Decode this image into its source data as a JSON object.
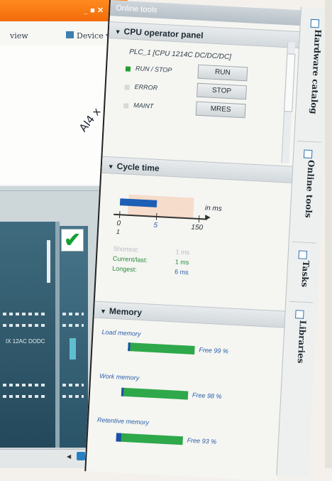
{
  "title_bar": {
    "window_controls": "_ ■ ✕",
    "mid_title": "Online tools"
  },
  "device_toolbar": {
    "network_view_tab": "view",
    "device_view_tab": "Device view"
  },
  "canvas": {
    "module_label": "AI4 x"
  },
  "plc_module": {
    "label": "IX 12AC DODC"
  },
  "cpu_panel": {
    "heading": "CPU operator panel",
    "device": "PLC_1 [CPU 1214C DC/DC/DC]",
    "rows": [
      {
        "indicator": "RUN / STOP",
        "button": "RUN",
        "led_color": "#20a030"
      },
      {
        "indicator": "ERROR",
        "button": "STOP",
        "led_color": "#d6d9da"
      },
      {
        "indicator": "MAINT",
        "button": "MRES",
        "led_color": "#d6d9da"
      }
    ]
  },
  "cycle_time": {
    "heading": "Cycle time",
    "unit": "in ms",
    "ticks": [
      "0",
      "5",
      "150"
    ],
    "tick_below": "1",
    "stats": [
      {
        "label": "Shortest:",
        "value": "1 ms"
      },
      {
        "label": "Current/last:",
        "value": "1 ms"
      },
      {
        "label": "Longest:",
        "value": "6 ms"
      }
    ]
  },
  "memory": {
    "heading": "Memory",
    "items": [
      {
        "name": "Load memory",
        "free_label": "Free 99 %",
        "free_fraction": 0.99
      },
      {
        "name": "Work memory",
        "free_label": "Free 98 %",
        "free_fraction": 0.98
      },
      {
        "name": "Retentive memory",
        "free_label": "Free 93 %",
        "free_fraction": 0.93
      }
    ]
  },
  "side_tabs": [
    "Hardware catalog",
    "Online tools",
    "Tasks",
    "Libraries"
  ],
  "colors": {
    "title_bar": "#f26b0a",
    "cycle_bar": "#1c5fb5",
    "memory_free": "#2ea84a",
    "check": "#15a035"
  },
  "icons": [
    "device-view-icon",
    "check-icon",
    "scroll-left-icon",
    "navigation-icon"
  ]
}
